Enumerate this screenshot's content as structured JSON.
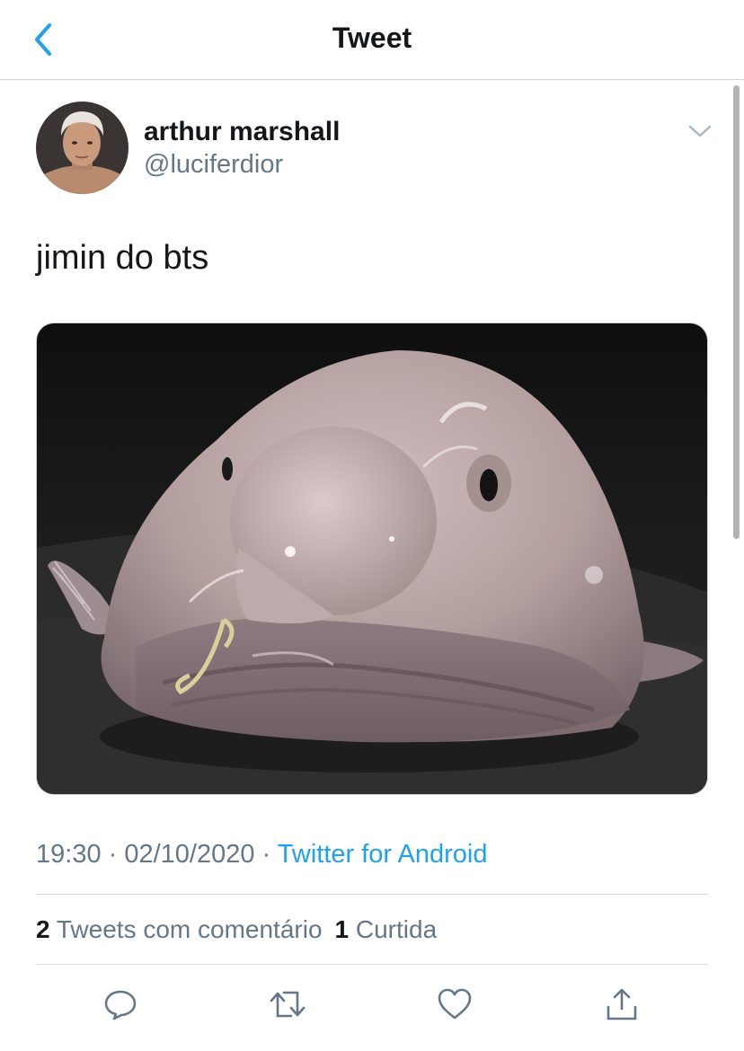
{
  "colors": {
    "accent": "#1da1f2",
    "text_primary": "#14171a",
    "text_secondary": "#657786",
    "divider": "#dadde0",
    "icon": "#657786"
  },
  "header": {
    "title": "Tweet",
    "back_icon": "chevron-left-icon"
  },
  "tweet": {
    "author": {
      "display_name": "arthur marshall",
      "handle": "@luciferdior"
    },
    "menu_icon": "chevron-down-icon",
    "text": "jimin do bts",
    "meta": {
      "time": "19:30",
      "separator1": " · ",
      "date": "02/10/2020",
      "separator2": " · ",
      "source": "Twitter for Android"
    },
    "stats": {
      "quote_count": "2",
      "quote_label": "Tweets com comentário",
      "like_count": "1",
      "like_label": "Curtida"
    },
    "actions": {
      "reply_icon": "reply-icon",
      "retweet_icon": "retweet-icon",
      "like_icon": "heart-icon",
      "share_icon": "share-icon"
    }
  }
}
